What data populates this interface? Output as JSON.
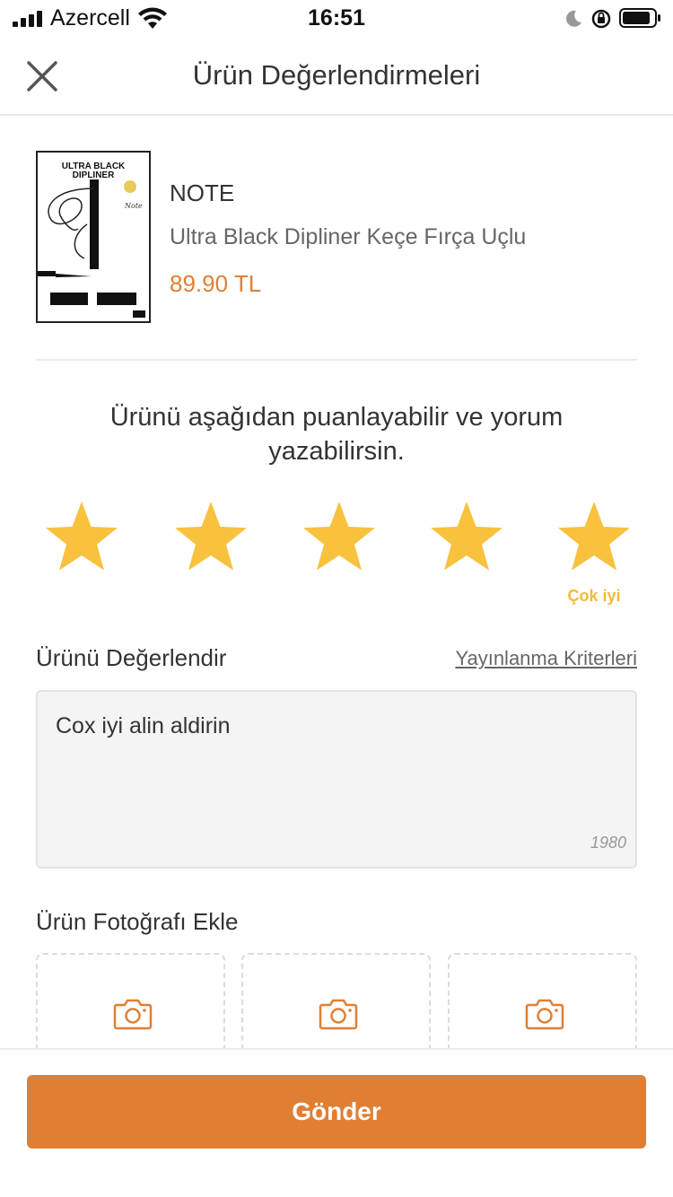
{
  "status_bar": {
    "carrier": "Azercell",
    "time": "16:51"
  },
  "header": {
    "title": "Ürün Değerlendirmeleri"
  },
  "product": {
    "brand": "NOTE",
    "name": "Ultra Black Dipliner Keçe Fırça Uçlu",
    "price": "89.90 TL",
    "image_label_line1": "ULTRA BLACK",
    "image_label_line2": "DIPLINER"
  },
  "rating": {
    "prompt": "Ürünü aşağıdan puanlayabilir ve yorum yazabilirsin.",
    "value": 5,
    "max": 5,
    "label": "Çok iyi",
    "star_color": "#f8c13e"
  },
  "review": {
    "title": "Ürünü Değerlendir",
    "criteria_link": "Yayınlanma Kriterleri",
    "text": "Cox iyi alin aldirin",
    "remaining_chars": "1980"
  },
  "photos": {
    "title": "Ürün Fotoğrafı Ekle",
    "slots": 3,
    "icon": "camera-icon"
  },
  "submit": {
    "label": "Gönder"
  },
  "colors": {
    "accent": "#e07f33",
    "star": "#f8c13e"
  }
}
